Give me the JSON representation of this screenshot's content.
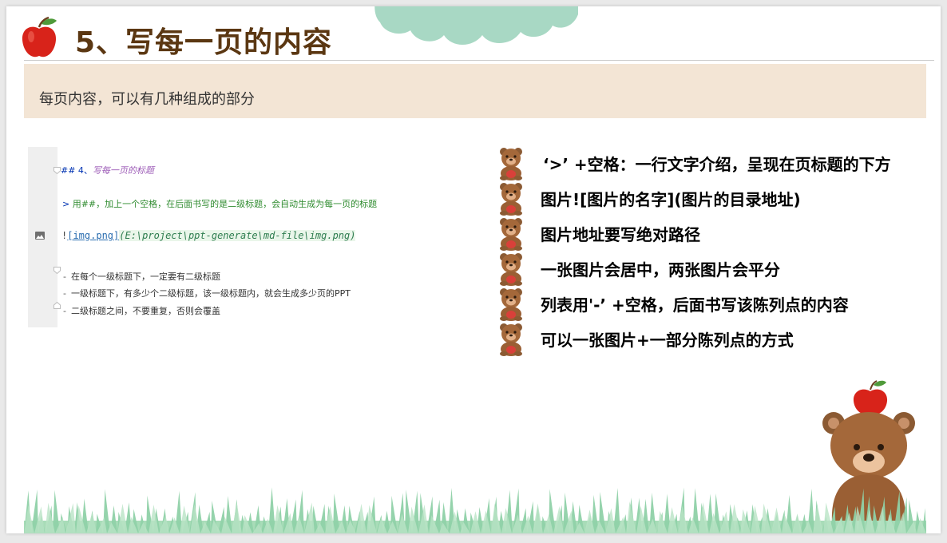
{
  "slide": {
    "title": "5、写每一页的内容",
    "subtitle": "每页内容，可以有几种组成的部分"
  },
  "editor": {
    "heading_prefix": "## 4、",
    "heading_text": "写每一页的标题",
    "quote_marker": ">",
    "quote_text": "用##，加上一个空格，在后面书写的是二级标题，会自动生成为每一页的标题",
    "image_bang": "!",
    "image_link_text": "[img.png]",
    "image_path": "(E:\\project\\ppt-generate\\md-file\\img.png)",
    "list_marker": "-",
    "list_items": [
      "在每个一级标题下，一定要有二级标题",
      "一级标题下，有多少个二级标题，该一级标题内，就会生成多少页的PPT",
      "二级标题之间，不要重复，否则会覆盖"
    ]
  },
  "bullets": [
    "‘>’ +空格：一行文字介绍，呈现在页标题的下方",
    "图片![图片的名字](图片的目录地址)",
    "图片地址要写绝对路径",
    "一张图片会居中，两张图片会平分",
    "列表用'-’ +空格，后面书写该陈列点的内容",
    "可以一张图片+一部分陈列点的方式"
  ],
  "icons": {
    "title": "apple-icon",
    "bullet": "bear-icon",
    "gutter": "image-icon",
    "decor": [
      "cloud",
      "grass",
      "bear-with-apple"
    ]
  },
  "colors": {
    "title": "#5b3712",
    "subtitle_band": "#f3e5d5",
    "grass": "#8fd1a8",
    "cloud": "#a8d8c4",
    "apple": "#d8231a",
    "bear": "#a4683a"
  }
}
